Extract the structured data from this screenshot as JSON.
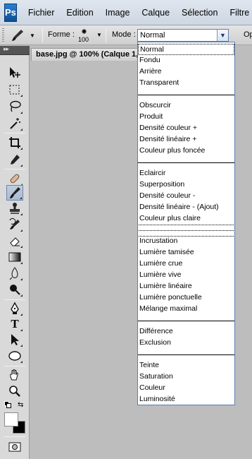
{
  "app": {
    "logo": "Ps",
    "menu": [
      "Fichier",
      "Edition",
      "Image",
      "Calque",
      "Sélection",
      "Filtre"
    ]
  },
  "options": {
    "forme_label": "Forme :",
    "brush_size": "100",
    "mode_label": "Mode :",
    "mode_value": "Normal",
    "opacity_label": "Op"
  },
  "document": {
    "tab_title": "base.jpg @ 100% (Calque 1,"
  },
  "blend_modes": {
    "groups": [
      [
        "Normal",
        "Fondu",
        "Arrière",
        "Transparent"
      ],
      [
        "Obscurcir",
        "Produit",
        "Densité couleur +",
        "Densité linéaire +",
        "Couleur plus foncée"
      ],
      [
        "Eclaircir",
        "Superposition",
        "Densité couleur -",
        "Densité linéaire - (Ajout)",
        "Couleur plus claire"
      ],
      [
        "Incrustation",
        "Lumière tamisée",
        "Lumière crue",
        "Lumière vive",
        "Lumière linéaire",
        "Lumière ponctuelle",
        "Mélange maximal"
      ],
      [
        "Différence",
        "Exclusion"
      ],
      [
        "Teinte",
        "Saturation",
        "Couleur",
        "Luminosité"
      ]
    ]
  },
  "tools": {
    "type_glyph": "T"
  }
}
